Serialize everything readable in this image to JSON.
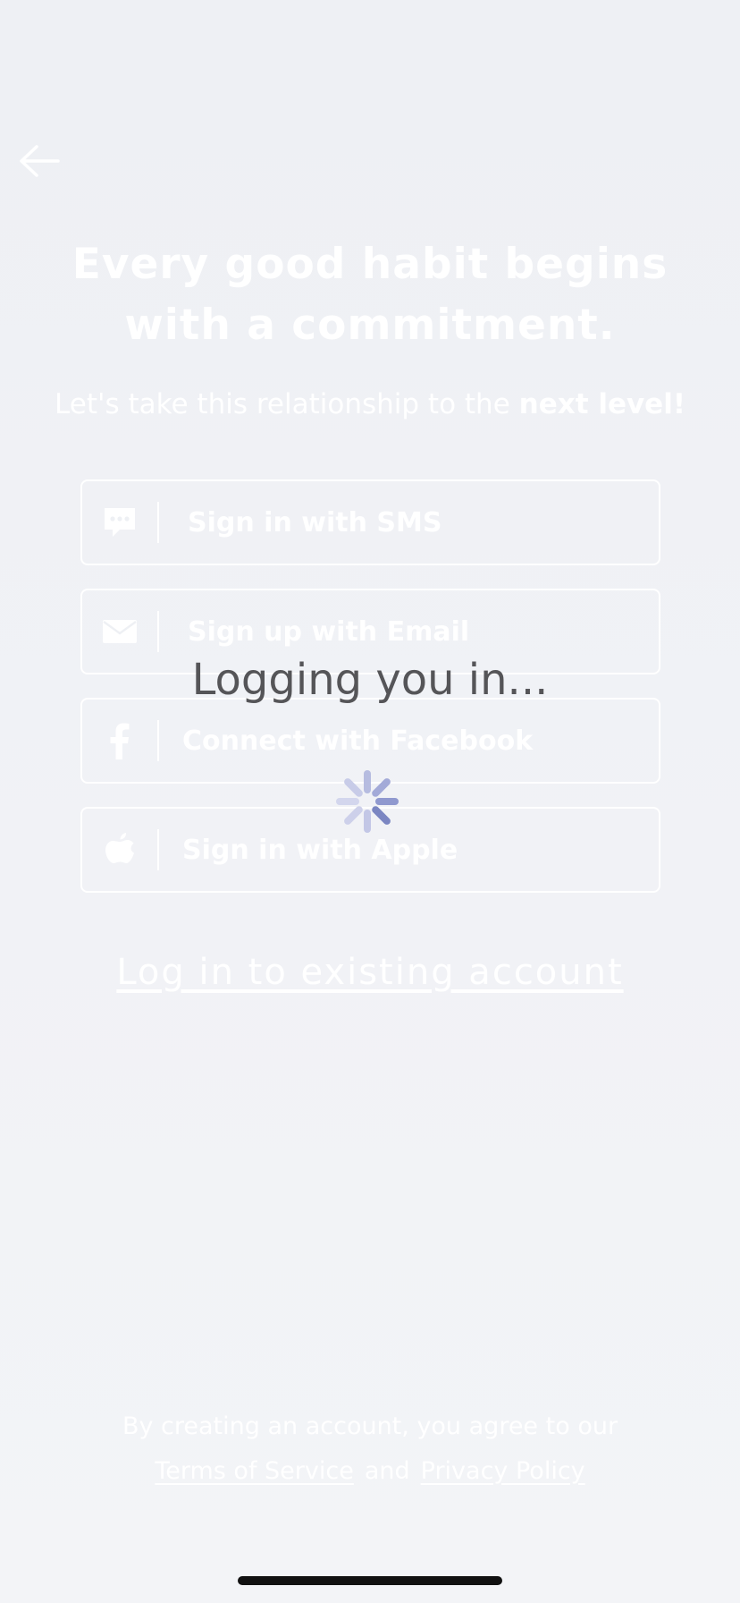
{
  "header": {
    "back_icon": "arrow-left-icon"
  },
  "hero": {
    "headline_line1": "Every good habit begins",
    "headline_line2": "with a commitment.",
    "subtitle_prefix": "Let's take this relationship to the ",
    "subtitle_bold": "next level!"
  },
  "auth_options": [
    {
      "label": "Sign in with SMS",
      "icon": "chat-bubble-icon"
    },
    {
      "label": "Sign up with Email",
      "icon": "envelope-icon"
    },
    {
      "label": "Connect with Facebook",
      "icon": "facebook-icon"
    },
    {
      "label": "Sign in with Apple",
      "icon": "apple-icon"
    }
  ],
  "existing_account": {
    "label": "Log in to existing account"
  },
  "legal": {
    "line1": "By creating an account, you agree to our",
    "terms_label": "Terms of Service",
    "and_label": "and",
    "privacy_label": "Privacy Policy"
  },
  "overlay": {
    "loading_text": "Logging you in..."
  },
  "colors": {
    "background": "#f3f4f7",
    "foreground": "#ffffff",
    "loading_text": "#555558",
    "spinner": "#7b86c2"
  }
}
